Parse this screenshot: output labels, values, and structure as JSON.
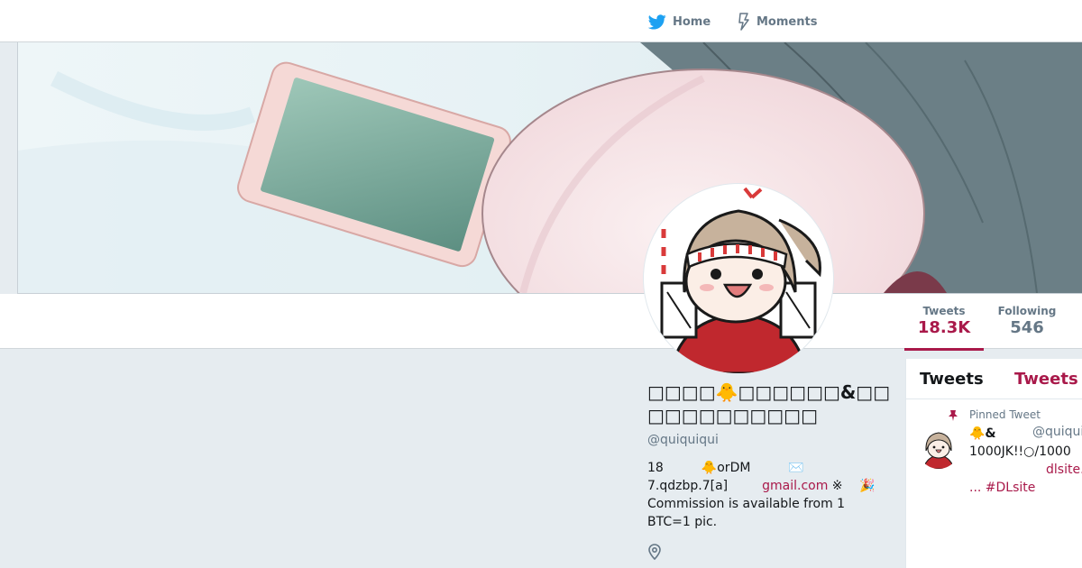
{
  "nav": {
    "home_label": "Home",
    "moments_label": "Moments"
  },
  "stats": {
    "tweets_label": "Tweets",
    "tweets_value": "18.3K",
    "following_label": "Following",
    "following_value": "546"
  },
  "profile": {
    "name": "□□□□🐥□□□□□□&□□□□□□□□□□□□",
    "handle": "@quiquiqui",
    "bio_line1": "18　　　🐥orDM　　　✉️",
    "bio_line2_prefix": "7.qdzbp.7[a]",
    "bio_link": "gmail.com",
    "bio_line2_suffix": " ※　 🎉",
    "bio_line3": "Commission is available from 1",
    "bio_line4": "BTC=1 pic."
  },
  "timeline": {
    "tab_active": "Tweets",
    "tab_other": "Tweets",
    "pinned_label": "Pinned Tweet",
    "tweet_line1": "🐥&",
    "tweet_handle": "@quiqui",
    "tweet_line2": "1000JK!!○/1000",
    "tweet_line3_link": "dlsite.",
    "tweet_line4": "... #DLsite"
  },
  "colors": {
    "accent": "#a9194a",
    "twitter_blue": "#1da1f2",
    "muted": "#657786",
    "background": "#e6ecf0"
  }
}
